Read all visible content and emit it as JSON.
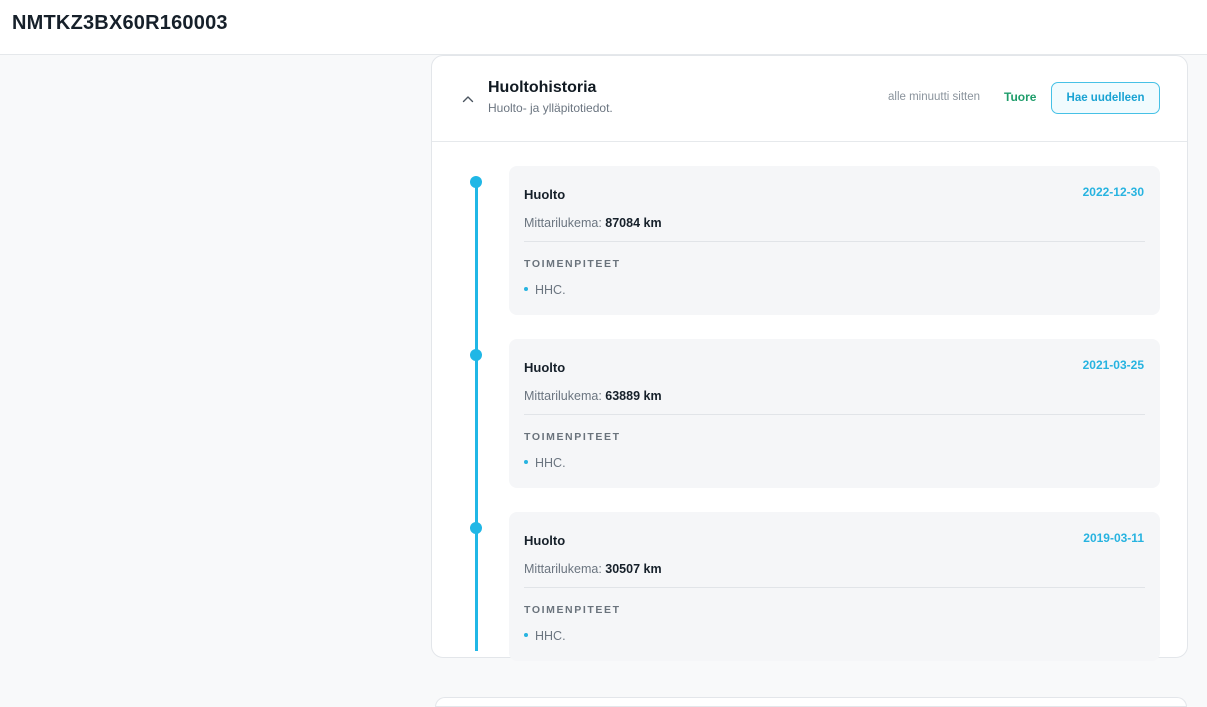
{
  "header": {
    "vin": "NMTKZ3BX60R160003"
  },
  "card": {
    "title": "Huoltohistoria",
    "subtitle": "Huolto- ja ylläpitotiedot.",
    "updated_text": "alle minuutti sitten",
    "status": "Tuore",
    "refresh_label": "Hae uudelleen",
    "icons": {
      "collapse": "chevron-up-icon"
    },
    "colors": {
      "accent": "#20b7e6",
      "status": "#1f9d6b"
    }
  },
  "entries": [
    {
      "type": "Huolto",
      "date": "2022-12-30",
      "odometer_label": "Mittarilukema:",
      "odometer_value": "87084 km",
      "actions_label": "TOIMENPITEET",
      "actions": [
        "HHC."
      ]
    },
    {
      "type": "Huolto",
      "date": "2021-03-25",
      "odometer_label": "Mittarilukema:",
      "odometer_value": "63889 km",
      "actions_label": "TOIMENPITEET",
      "actions": [
        "HHC."
      ]
    },
    {
      "type": "Huolto",
      "date": "2019-03-11",
      "odometer_label": "Mittarilukema:",
      "odometer_value": "30507 km",
      "actions_label": "TOIMENPITEET",
      "actions": [
        "HHC."
      ]
    }
  ]
}
